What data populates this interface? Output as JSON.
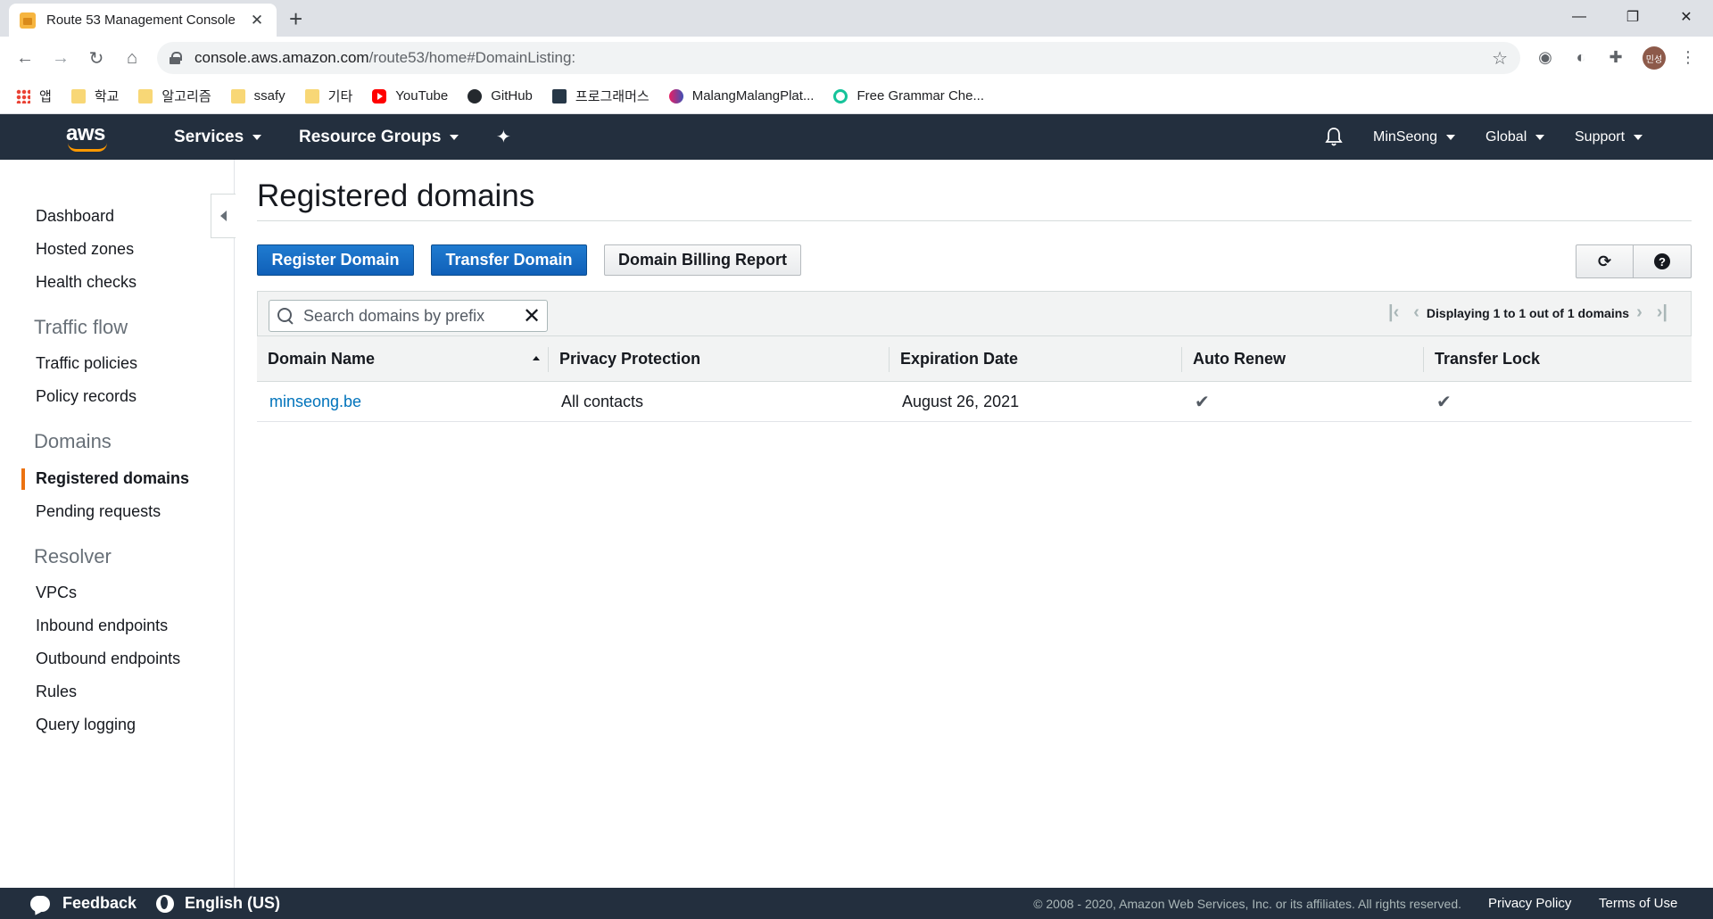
{
  "browser": {
    "tab_title": "Route 53 Management Console",
    "url_host": "console.aws.amazon.com",
    "url_path": "/route53/home#DomainListing:",
    "profile_initials": "민성",
    "bookmarks": [
      "앱",
      "학교",
      "알고리즘",
      "ssafy",
      "기타",
      "YouTube",
      "GitHub",
      "프로그래머스",
      "MalangMalangPlat...",
      "Free Grammar Che..."
    ]
  },
  "aws_nav": {
    "logo": "aws",
    "services": "Services",
    "resource_groups": "Resource Groups",
    "user": "MinSeong",
    "region": "Global",
    "support": "Support"
  },
  "sidebar": {
    "top_items": [
      "Dashboard",
      "Hosted zones",
      "Health checks"
    ],
    "traffic_flow": {
      "title": "Traffic flow",
      "items": [
        "Traffic policies",
        "Policy records"
      ]
    },
    "domains": {
      "title": "Domains",
      "items": [
        "Registered domains",
        "Pending requests"
      ],
      "active": "Registered domains"
    },
    "resolver": {
      "title": "Resolver",
      "items": [
        "VPCs",
        "Inbound endpoints",
        "Outbound endpoints",
        "Rules",
        "Query logging"
      ]
    }
  },
  "main": {
    "title": "Registered domains",
    "buttons": {
      "register": "Register Domain",
      "transfer": "Transfer Domain",
      "billing": "Domain Billing Report"
    },
    "search_placeholder": "Search domains by prefix",
    "pager_text": "Displaying 1 to 1 out of 1 domains",
    "columns": [
      "Domain Name",
      "Privacy Protection",
      "Expiration Date",
      "Auto Renew",
      "Transfer Lock"
    ],
    "rows": [
      {
        "domain": "minseong.be",
        "privacy": "All contacts",
        "expiration": "August 26, 2021",
        "auto_renew": "✔",
        "transfer_lock": "✔"
      }
    ]
  },
  "footer": {
    "feedback": "Feedback",
    "language": "English (US)",
    "copyright": "© 2008 - 2020, Amazon Web Services, Inc. or its affiliates. All rights reserved.",
    "privacy": "Privacy Policy",
    "terms": "Terms of Use"
  },
  "colors": {
    "aws_nav_bg": "#232f3e",
    "primary_button": "#1166bb",
    "link": "#0073bb",
    "active_indicator": "#ec7211"
  }
}
